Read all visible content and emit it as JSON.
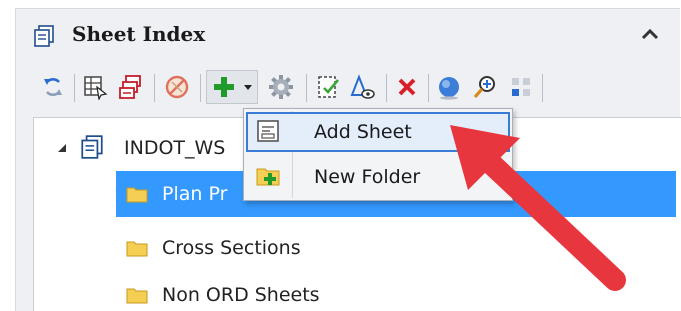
{
  "panel": {
    "title": "Sheet Index"
  },
  "toolbar": {
    "buttons": [
      {
        "icon": "refresh-icon"
      },
      {
        "icon": "sheet-properties-icon"
      },
      {
        "icon": "sheet-stack-icon"
      },
      {
        "icon": "cancel-icon"
      },
      {
        "icon": "add-icon"
      },
      {
        "icon": "gear-icon"
      },
      {
        "icon": "edit-document-icon"
      },
      {
        "icon": "triangle-eye-icon"
      },
      {
        "icon": "delete-icon"
      },
      {
        "icon": "globe-icon"
      },
      {
        "icon": "zoom-in-icon"
      },
      {
        "icon": "grid-icon"
      }
    ]
  },
  "tree": {
    "root": {
      "label": "INDOT_WS"
    },
    "children": [
      {
        "label": "Plan Pr",
        "selected": true
      },
      {
        "label": "Cross Sections",
        "selected": false
      },
      {
        "label": "Non ORD Sheets",
        "selected": false
      }
    ]
  },
  "menu": {
    "items": [
      {
        "label": "Add Sheet",
        "icon": "add-sheet-icon",
        "highlighted": true
      },
      {
        "label": "New Folder",
        "icon": "new-folder-icon",
        "highlighted": false
      }
    ]
  },
  "colors": {
    "selection": "#3399ff",
    "panel_bg": "#eef0f4",
    "menu_highlight_border": "#3a7bd5",
    "annotation_arrow": "#e8363f",
    "add_green": "#1f9a2b",
    "delete_red": "#d7202a"
  }
}
